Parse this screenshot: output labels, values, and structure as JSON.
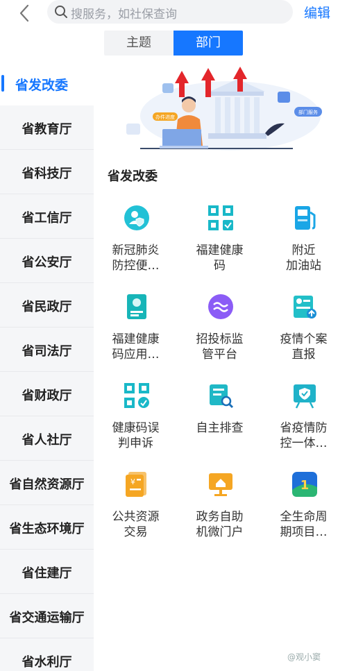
{
  "search": {
    "placeholder": "搜服务，如社保查询"
  },
  "header": {
    "edit_label": "编辑"
  },
  "tabs": [
    {
      "label": "主题"
    },
    {
      "label": "部门"
    }
  ],
  "sidebar": {
    "items": [
      {
        "label": "省发改委"
      },
      {
        "label": "省教育厅"
      },
      {
        "label": "省科技厅"
      },
      {
        "label": "省工信厅"
      },
      {
        "label": "省公安厅"
      },
      {
        "label": "省民政厅"
      },
      {
        "label": "省司法厅"
      },
      {
        "label": "省财政厅"
      },
      {
        "label": "省人社厅"
      },
      {
        "label": "省自然资源厅"
      },
      {
        "label": "省生态环境厅"
      },
      {
        "label": "省住建厅"
      },
      {
        "label": "省交通运输厅"
      },
      {
        "label": "省水利厅"
      }
    ]
  },
  "banner": {
    "tag1": "办件进度",
    "tag2": "部门服务"
  },
  "section": {
    "title": "省发改委"
  },
  "services": [
    {
      "line1": "新冠肺炎",
      "line2": "防控便…",
      "icon": "shield-person-icon"
    },
    {
      "line1": "福建健康",
      "line2": "码",
      "icon": "qr-code-icon"
    },
    {
      "line1": "附近",
      "line2": "加油站",
      "icon": "fuel-pump-icon"
    },
    {
      "line1": "福建健康",
      "line2": "码应用…",
      "icon": "health-card-icon"
    },
    {
      "line1": "招投标监",
      "line2": "管平台",
      "icon": "tender-platform-icon"
    },
    {
      "line1": "疫情个案",
      "line2": "直报",
      "icon": "case-report-icon"
    },
    {
      "line1": "健康码误",
      "line2": "判申诉",
      "icon": "qr-appeal-icon"
    },
    {
      "line1": "自主排查",
      "line2": "",
      "icon": "self-check-icon"
    },
    {
      "line1": "省疫情防",
      "line2": "控一体…",
      "icon": "epidemic-board-icon"
    },
    {
      "line1": "公共资源",
      "line2": "交易",
      "icon": "resource-trade-icon"
    },
    {
      "line1": "政务自助",
      "line2": "机微门户",
      "icon": "kiosk-portal-icon"
    },
    {
      "line1": "全生命周",
      "line2": "期项目…",
      "icon": "lifecycle-project-icon"
    }
  ],
  "watermark": {
    "text": "@观小窦"
  },
  "colors": {
    "accent": "#1677ff",
    "orange": "#f5a623",
    "teal": "#1fbfc4",
    "purple": "#8b5cf6"
  }
}
